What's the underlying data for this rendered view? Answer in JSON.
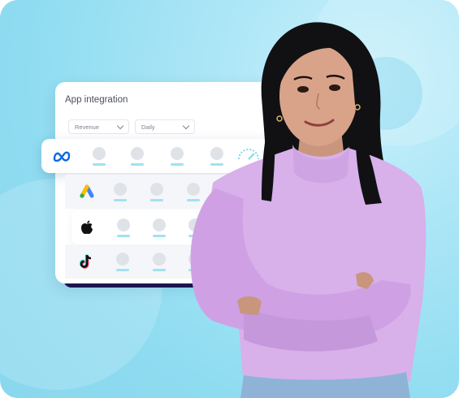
{
  "card": {
    "title": "App integration",
    "filter_metric": "Revenue",
    "filter_period": "Daily"
  },
  "rows": [
    {
      "app": "Meta",
      "icon": "meta-icon"
    },
    {
      "app": "Google Ads",
      "icon": "google-ads-icon"
    },
    {
      "app": "Apple",
      "icon": "apple-icon"
    },
    {
      "app": "TikTok",
      "icon": "tiktok-icon"
    }
  ],
  "colors": {
    "background": "#8fdcf1",
    "accent": "#9fe2f3",
    "card_shadow": "#1d1450",
    "sweater": "#d9b3ea"
  }
}
